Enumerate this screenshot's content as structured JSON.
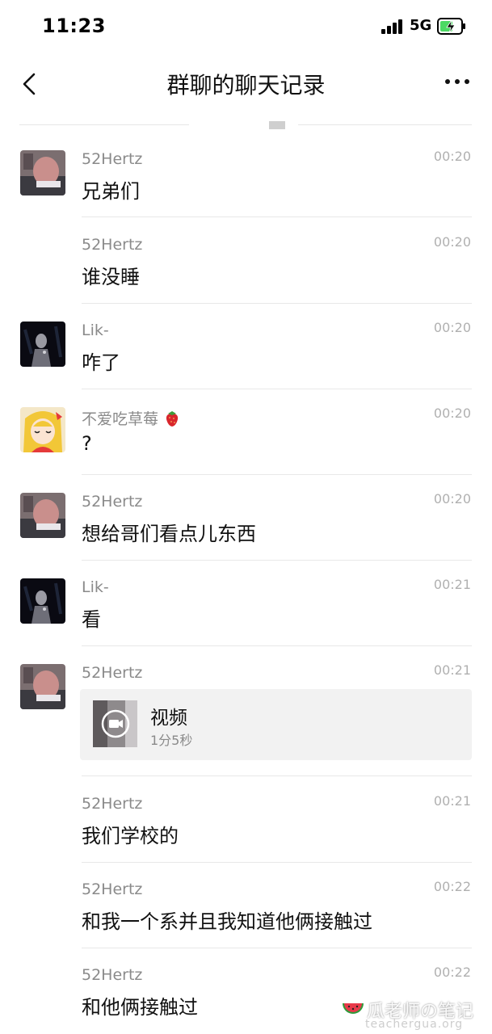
{
  "status_bar": {
    "time": "11:23",
    "network": "5G"
  },
  "nav": {
    "title": "群聊的聊天记录"
  },
  "messages": [
    {
      "sender": "52Hertz",
      "time": "00:20",
      "text": "兄弟们",
      "avatar": "hertz"
    },
    {
      "sender": "52Hertz",
      "time": "00:20",
      "text": "谁没睡",
      "avatar": ""
    },
    {
      "sender": "Lik-",
      "time": "00:20",
      "text": "咋了",
      "avatar": "lik"
    },
    {
      "sender": "不爱吃草莓",
      "time": "00:20",
      "text": "?",
      "avatar": "anime"
    },
    {
      "sender": "52Hertz",
      "time": "00:20",
      "text": "想给哥们看点儿东西",
      "avatar": "hertz"
    },
    {
      "sender": "Lik-",
      "time": "00:21",
      "text": "看",
      "avatar": "lik"
    },
    {
      "sender": "52Hertz",
      "time": "00:21",
      "video": {
        "title": "视频",
        "duration": "1分5秒"
      },
      "avatar": "hertz"
    },
    {
      "sender": "52Hertz",
      "time": "00:21",
      "text": "我们学校的",
      "avatar": ""
    },
    {
      "sender": "52Hertz",
      "time": "00:22",
      "text": "和我一个系并且我知道他俩接触过",
      "avatar": ""
    },
    {
      "sender": "52Hertz",
      "time": "00:22",
      "text": "和他俩接触过",
      "avatar": ""
    }
  ],
  "watermark": {
    "text": "瓜老师の笔记",
    "url": "teachergua.org"
  },
  "colors": {
    "accent_text": "#111111",
    "meta_text": "#8a8a8a",
    "divider": "#e8e8e8",
    "battery_green": "#4cd964"
  }
}
